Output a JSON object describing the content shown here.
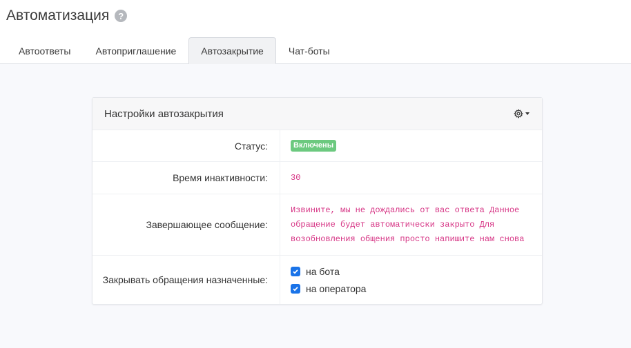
{
  "header": {
    "title": "Автоматизация",
    "help_icon": "?"
  },
  "tabs": [
    {
      "label": "Автоответы",
      "active": false
    },
    {
      "label": "Автоприглашение",
      "active": false
    },
    {
      "label": "Автозакрытие",
      "active": true
    },
    {
      "label": "Чат-боты",
      "active": false
    }
  ],
  "card": {
    "title": "Настройки автозакрытия",
    "settings_icon": "gear-icon",
    "rows": {
      "status": {
        "label": "Статус:",
        "value": "Включены"
      },
      "inactivity": {
        "label": "Время инактивности:",
        "value": "30"
      },
      "message": {
        "label": "Завершающее сообщение:",
        "value": "Извините, мы не дождались от вас ответа Данное обращение будет автоматически закрыто Для возобновления общения просто напишите нам снова"
      },
      "close_assigned": {
        "label": "Закрывать обращения назначенные:",
        "options": [
          {
            "label": "на бота",
            "checked": true
          },
          {
            "label": "на оператора",
            "checked": true
          }
        ]
      }
    }
  },
  "colors": {
    "accent": "#1a73e8",
    "status_green": "#6cc97f",
    "code_pink": "#d63384",
    "background": "#f8f9fc"
  }
}
